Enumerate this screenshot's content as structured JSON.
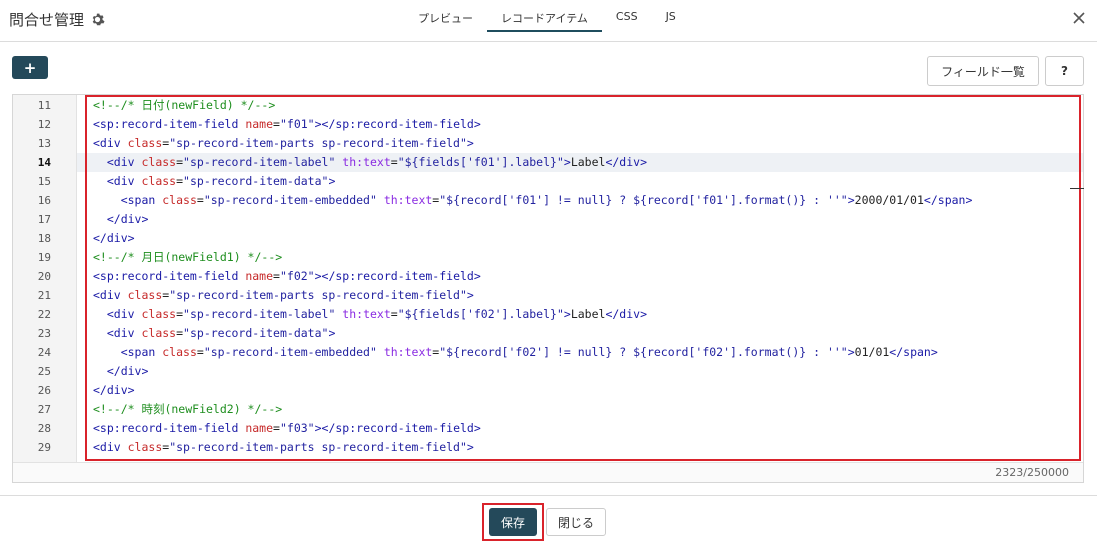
{
  "header": {
    "title": "問合せ管理",
    "tabs": [
      {
        "label": "プレビュー",
        "active": false
      },
      {
        "label": "レコードアイテム",
        "active": true
      },
      {
        "label": "CSS",
        "active": false
      },
      {
        "label": "JS",
        "active": false
      }
    ]
  },
  "toolbar": {
    "add_label": "+",
    "field_list_label": "フィールド一覧",
    "help_label": "?"
  },
  "editor": {
    "current_line": 14,
    "lines": [
      {
        "num": "11",
        "text": "<!--/* 日付(newField) */-->"
      },
      {
        "num": "12",
        "text": "<sp:record-item-field name=\"f01\"></sp:record-item-field>"
      },
      {
        "num": "13",
        "text": "<div class=\"sp-record-item-parts sp-record-item-field\">"
      },
      {
        "num": "14",
        "text": "  <div class=\"sp-record-item-label\" th:text=\"${fields['f01'].label}\">Label</div>"
      },
      {
        "num": "15",
        "text": "  <div class=\"sp-record-item-data\">"
      },
      {
        "num": "16",
        "text": "    <span class=\"sp-record-item-embedded\" th:text=\"${record['f01'] != null} ? ${record['f01'].format()} : ''\">2000/01/01</span>"
      },
      {
        "num": "17",
        "text": "  </div>"
      },
      {
        "num": "18",
        "text": "</div>"
      },
      {
        "num": "19",
        "text": "<!--/* 月日(newField1) */-->"
      },
      {
        "num": "20",
        "text": "<sp:record-item-field name=\"f02\"></sp:record-item-field>"
      },
      {
        "num": "21",
        "text": "<div class=\"sp-record-item-parts sp-record-item-field\">"
      },
      {
        "num": "22",
        "text": "  <div class=\"sp-record-item-label\" th:text=\"${fields['f02'].label}\">Label</div>"
      },
      {
        "num": "23",
        "text": "  <div class=\"sp-record-item-data\">"
      },
      {
        "num": "24",
        "text": "    <span class=\"sp-record-item-embedded\" th:text=\"${record['f02'] != null} ? ${record['f02'].format()} : ''\">01/01</span>"
      },
      {
        "num": "25",
        "text": "  </div>"
      },
      {
        "num": "26",
        "text": "</div>"
      },
      {
        "num": "27",
        "text": "<!--/* 時刻(newField2) */-->"
      },
      {
        "num": "28",
        "text": "<sp:record-item-field name=\"f03\"></sp:record-item-field>"
      },
      {
        "num": "29",
        "text": "<div class=\"sp-record-item-parts sp-record-item-field\">"
      }
    ],
    "char_count": "2323/250000"
  },
  "footer": {
    "save_label": "保存",
    "close_label": "閉じる"
  },
  "colors": {
    "primary": "#24495a",
    "highlight": "#d9232b",
    "comment": "#1e8e1e",
    "attribute": "#c62a2a",
    "tag": "#1a1aa6"
  }
}
